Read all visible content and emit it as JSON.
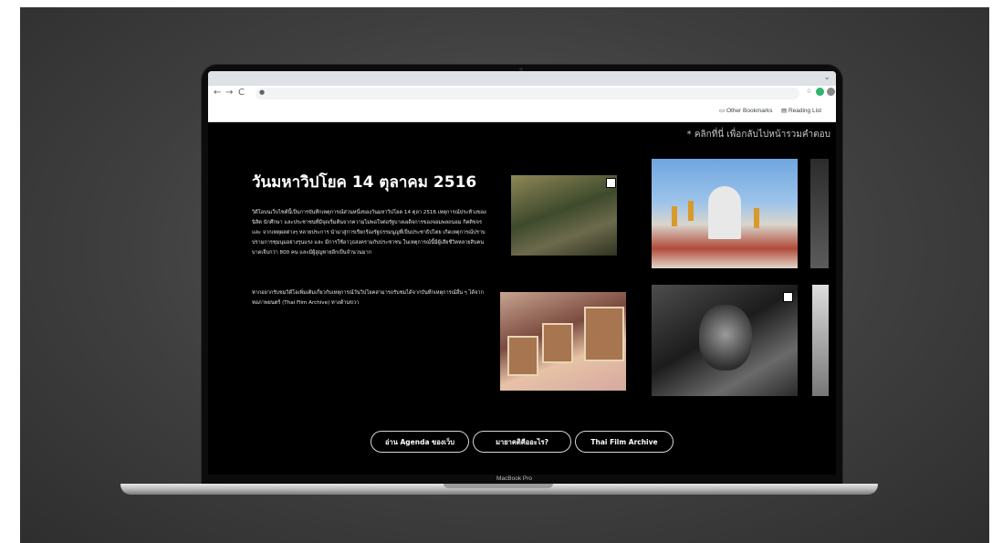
{
  "browser": {
    "nav": {
      "back": "←",
      "forward": "→",
      "reload": "C"
    },
    "lock_icon": "lock-icon",
    "url": "",
    "bookmarks": {
      "other_label": "Other Bookmarks",
      "reading_list_label": "Reading List"
    },
    "tab_chevron": "⌄"
  },
  "page": {
    "back_link": "* คลิกที่นี่ เพื่อกลับไปหน้ารวมคำตอบ",
    "title": "วันมหาวิปโยค 14 ตุลาคม 2516",
    "paragraph1": "วิดีโอบนเว็บไซต์นี้เป็นการบันทึกเหตุการณ์ส่วนหนึ่งของวันมหาวิปโยค 14 ตุลา 2516 เหตุการณ์ประท้วงของนิสิต นักศึกษา และประชาชนที่มีจุดเริ่มต้นจากความไม่พอใจต่อรัฐบาลเผด็จการของจอมพลถนอม กิตติขจร และ จากเหตุผลต่างๆ หลายประการ นำมาสู่การเรียกร้องรัฐธรรมนูญที่เป็นประชาธิปไตย เกิดเหตุการณ์ปราบปรามการชุมนุมอย่างรุนแรง และ มีการใช้อาวุธสงครามกับประชาชน ในเหตุการณ์นี้มีผู้เสียชีวิตหลายสิบคน บาดเจ็บกว่า 800 คน และมีผู้สูญหายอีกเป็นจำนวนมาก",
    "paragraph2": "หากอยากรับชมวิดีโอเพิ่มเติมเกี่ยวกับเหตุการณ์วันวิปโยคสามารถรับชมได้จากบันทึกเหตุการณ์อื่น ๆ ได้จากหอภาพยนตร์ (Thai Film Archive) ทางด้านขวา",
    "buttons": [
      "อ่าน Agenda ของเว็บ",
      "มายาคติคืออะไร?",
      "Thai Film Archive"
    ]
  },
  "device": {
    "model_label": "MacBook Pro"
  },
  "colors": {
    "page_bg": "#000000",
    "chrome_bg": "#f1f3f4",
    "stage_bg": "#3f3f3f"
  }
}
